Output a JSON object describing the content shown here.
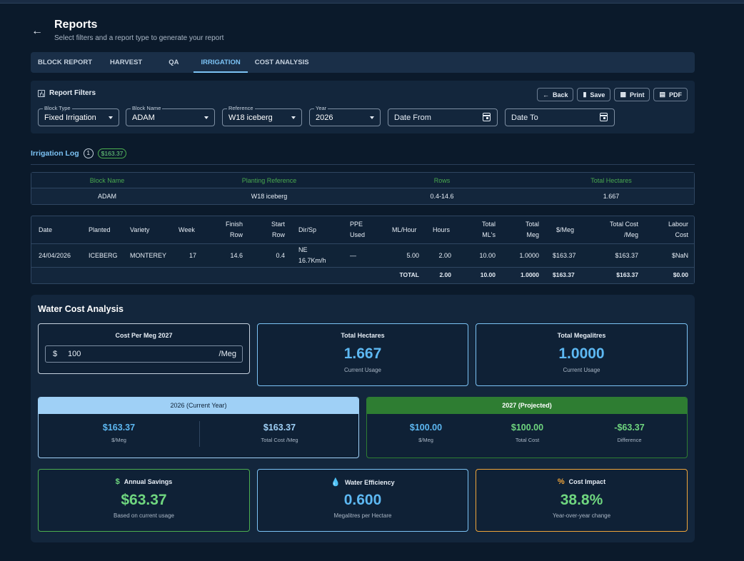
{
  "header": {
    "title": "Reports",
    "subtitle": "Select filters and a report type to generate your report"
  },
  "tabs": [
    {
      "label": "BLOCK REPORT",
      "active": false
    },
    {
      "label": "HARVEST",
      "active": false
    },
    {
      "label": "QA",
      "active": false
    },
    {
      "label": "IRRIGATION",
      "active": true
    },
    {
      "label": "COST ANALYSIS",
      "active": false
    }
  ],
  "filters": {
    "title": "Report Filters",
    "buttons": {
      "back": "Back",
      "save": "Save",
      "print": "Print",
      "pdf": "PDF"
    },
    "block_type": {
      "label": "Block Type",
      "value": "Fixed Irrigation"
    },
    "block_name": {
      "label": "Block Name",
      "value": "ADAM"
    },
    "reference": {
      "label": "Reference",
      "value": "W18 iceberg"
    },
    "year": {
      "label": "Year",
      "value": "2026"
    },
    "date_from": {
      "placeholder": "Date From"
    },
    "date_to": {
      "placeholder": "Date To"
    }
  },
  "log": {
    "title": "Irrigation Log",
    "count": "1",
    "total_badge": "$163.37"
  },
  "summary": {
    "headers": [
      "Block Name",
      "Planting Reference",
      "Rows",
      "Total Hectares"
    ],
    "values": [
      "ADAM",
      "W18 iceberg",
      "0.4-14.6",
      "1.667"
    ]
  },
  "detail": {
    "headers": {
      "date": "Date",
      "planted": "Planted",
      "variety": "Variety",
      "week": "Week",
      "finish_row_1": "Finish",
      "finish_row_2": "Row",
      "start_row_1": "Start",
      "start_row_2": "Row",
      "dirsp": "Dir/Sp",
      "ppe_1": "PPE",
      "ppe_2": "Used",
      "mlhour": "ML/Hour",
      "hours": "Hours",
      "total_ml_1": "Total",
      "total_ml_2": "ML's",
      "total_meg_1": "Total",
      "total_meg_2": "Meg",
      "per_meg": "$/Meg",
      "total_cost_1": "Total Cost",
      "total_cost_2": "/Meg",
      "labour_1": "Labour",
      "labour_2": "Cost"
    },
    "row": {
      "date": "24/04/2026",
      "planted": "ICEBERG",
      "variety": "MONTEREY",
      "week": "17",
      "finish_row": "14.6",
      "start_row": "0.4",
      "dir": "NE",
      "speed": "16.7Km/h",
      "ppe": "—",
      "mlhour": "5.00",
      "hours": "2.00",
      "total_ml": "10.00",
      "total_meg": "1.0000",
      "per_meg": "$163.37",
      "total_cost": "$163.37",
      "labour": "$NaN"
    },
    "totals": {
      "label": "TOTAL",
      "hours": "2.00",
      "total_ml": "10.00",
      "total_meg": "1.0000",
      "per_meg": "$163.37",
      "total_cost": "$163.37",
      "labour": "$0.00"
    }
  },
  "wca": {
    "title": "Water Cost Analysis",
    "cost_per_meg": {
      "title": "Cost Per Meg 2027",
      "currency": "$",
      "value": "100",
      "unit": "/Meg"
    },
    "total_hectares": {
      "title": "Total Hectares",
      "value": "1.667",
      "sub": "Current Usage"
    },
    "total_megalitres": {
      "title": "Total Megalitres",
      "value": "1.0000",
      "sub": "Current Usage"
    },
    "current_year": {
      "title": "2026 (Current Year)",
      "per_meg": "$163.37",
      "per_meg_label": "$/Meg",
      "total_cost": "$163.37",
      "total_cost_label": "Total Cost /Meg"
    },
    "projected": {
      "title": "2027 (Projected)",
      "per_meg": "$100.00",
      "per_meg_label": "$/Meg",
      "total_cost": "$100.00",
      "total_cost_label": "Total Cost",
      "difference": "-$63.37",
      "difference_label": "Difference"
    },
    "annual_savings": {
      "icon": "$",
      "title": "Annual Savings",
      "value": "$63.37",
      "sub": "Based on current usage"
    },
    "water_efficiency": {
      "title": "Water Efficiency",
      "value": "0.600",
      "sub": "Megalitres per Hectare"
    },
    "cost_impact": {
      "icon": "%",
      "title": "Cost Impact",
      "value": "38.8%",
      "sub": "Year-over-year change"
    }
  },
  "colors": {
    "background": "#0b1a2b",
    "accent_blue": "#7cc3f5",
    "accent_green": "#2e7d32",
    "value_green": "#6fd67f",
    "accent_orange": "#f0a53a"
  }
}
